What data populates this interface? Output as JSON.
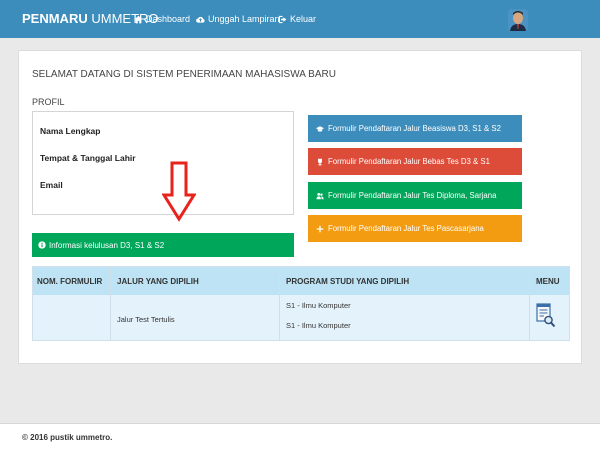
{
  "navbar": {
    "brand_bold": "PENMARU",
    "brand_rest": " UMMETRO",
    "items": [
      {
        "label": "Dashboard",
        "icon": "home-icon"
      },
      {
        "label": "Unggah Lampiran",
        "icon": "cloud-upload-icon"
      },
      {
        "label": "Keluar",
        "icon": "sign-out-icon"
      }
    ],
    "color": "#3c8dbc"
  },
  "main": {
    "welcome": "SELAMAT DATANG DI SISTEM PENERIMAAN MAHASISWA BARU",
    "profil_title": "PROFIL",
    "profil_fields": [
      "Nama Lengkap",
      "Tempat & Tanggal Lahir",
      "Email"
    ],
    "info_button": "Informasi kelulusan D3, S1 & S2",
    "form_buttons": [
      {
        "label": "Formulir Pendaftaran Jalur Beasiswa D3, S1 & S2",
        "color": "#3c8dbc",
        "icon": "graduation-cap-icon"
      },
      {
        "label": "Formulir Pendaftaran Jalur Bebas Tes D3 & S1",
        "color": "#dd4b39",
        "icon": "trophy-icon"
      },
      {
        "label": "Formulir Pendaftaran Jalur Tes Diploma, Sarjana",
        "color": "#00a65a",
        "icon": "users-icon"
      },
      {
        "label": "Formulir Pendaftaran Jalur Tes Pascasarjana",
        "color": "#f39c12",
        "icon": "plus-icon"
      }
    ]
  },
  "table": {
    "headers": [
      "NOM. FORMULIR",
      "JALUR YANG DIPILIH",
      "PROGRAM STUDI YANG DIPILIH",
      "MENU"
    ],
    "row": {
      "nom_formulir": "",
      "jalur": "Jalur Test Tertulis",
      "prodi": [
        "S1 - Ilmu Komputer",
        "S1 - Ilmu Komputer"
      ],
      "menu_icon": "document-search-icon"
    }
  },
  "footer": {
    "text": "© 2016 pustik ummetro."
  }
}
